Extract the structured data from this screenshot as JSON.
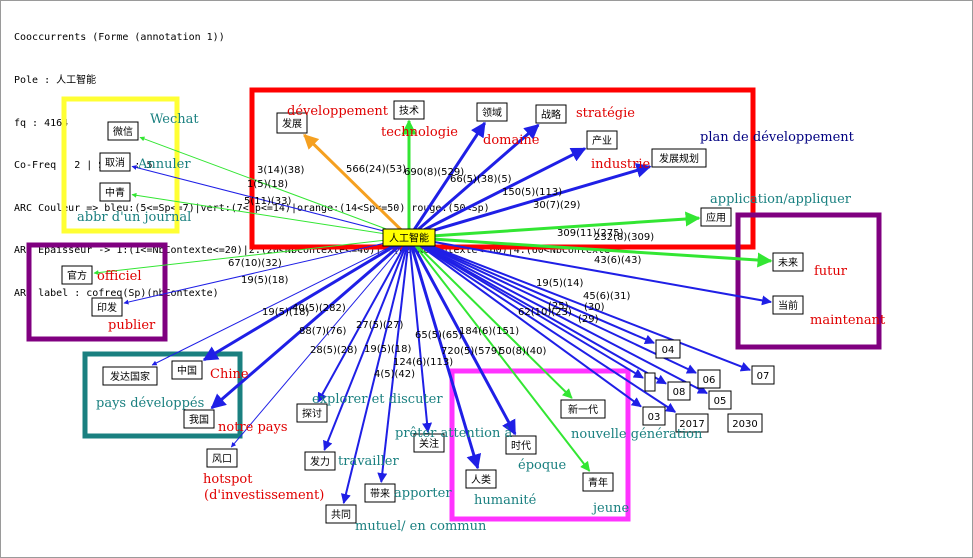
{
  "header": [
    "Cooccurrents (Forme (annotation 1))",
    "Pole : 人工智能",
    "fq : 4164",
    "Co-Freq : 2 | Seuil : 5",
    "ARC Couleur => bleu:(5<=Sp<=7)|vert:(7<Sp<=14)|orange:(14<Sp<=50)|rouge:(50<Sp)",
    "ARC Epaisseur -> 1:(1<=NbContexte<=20)|2:(20<NbContexte<=40)|3:(40<NbContexte<=60)|4:(60<NbContexte",
    "ARC label : cofreq(Sp)(nbContexte)"
  ],
  "colors": {
    "bleu": "#1f1fe6",
    "vert": "#33e633",
    "orange": "#f5a020",
    "rouge": "#e00000",
    "red_frame": "#ff0000",
    "yellow_frame": "#ffff33",
    "purple_frame": "#800080",
    "teal_frame": "#1a8080",
    "magenta_frame": "#ff33ff",
    "center_fill": "#ffff00",
    "translation_red": "#e00000",
    "translation_teal": "#1a8080",
    "translation_navy": "#000080"
  },
  "pole": "人工智能",
  "nodes": [
    {
      "id": "n_weixin",
      "text": "微信"
    },
    {
      "id": "n_quxiao",
      "text": "取消"
    },
    {
      "id": "n_zhongqi",
      "text": "中青"
    },
    {
      "id": "n_guanfang",
      "text": "官方"
    },
    {
      "id": "n_yinfa",
      "text": "印发"
    },
    {
      "id": "n_fada",
      "text": "发达国家"
    },
    {
      "id": "n_zhongguo",
      "text": "中国"
    },
    {
      "id": "n_woguo",
      "text": "我国"
    },
    {
      "id": "n_fengkou",
      "text": "风口"
    },
    {
      "id": "n_tantao",
      "text": "探讨"
    },
    {
      "id": "n_fali",
      "text": "发力"
    },
    {
      "id": "n_daile",
      "text": "带来"
    },
    {
      "id": "n_gongtong",
      "text": "共同"
    },
    {
      "id": "n_guanzhu",
      "text": "关注"
    },
    {
      "id": "n_renlei",
      "text": "人类"
    },
    {
      "id": "n_shidai",
      "text": "时代"
    },
    {
      "id": "n_xinyidai",
      "text": "新一代"
    },
    {
      "id": "n_qingnian",
      "text": "青年"
    },
    {
      "id": "n_fazhan",
      "text": "发展"
    },
    {
      "id": "n_jishu",
      "text": "技术"
    },
    {
      "id": "n_lingyu",
      "text": "领域"
    },
    {
      "id": "n_zhanlue",
      "text": "战略"
    },
    {
      "id": "n_chanye",
      "text": "产业"
    },
    {
      "id": "n_guihua",
      "text": "发展规划"
    },
    {
      "id": "n_yingyong",
      "text": "应用"
    },
    {
      "id": "n_weilai",
      "text": "未来"
    },
    {
      "id": "n_dangqian",
      "text": "当前"
    },
    {
      "id": "n_04",
      "text": "04"
    },
    {
      "id": "n_blank",
      "text": ""
    },
    {
      "id": "n_08",
      "text": "08"
    },
    {
      "id": "n_06",
      "text": "06"
    },
    {
      "id": "n_07",
      "text": "07"
    },
    {
      "id": "n_05",
      "text": "05"
    },
    {
      "id": "n_03",
      "text": "03"
    },
    {
      "id": "n_2017",
      "text": "2017"
    },
    {
      "id": "n_2030",
      "text": "2030"
    }
  ],
  "edges": [
    {
      "to": "n_fazhan",
      "color": "orange",
      "width": 3,
      "label": ""
    },
    {
      "to": "n_jishu",
      "color": "vert",
      "width": 3,
      "label": "566(24)(53)"
    },
    {
      "to": "n_lingyu",
      "color": "bleu",
      "width": 3,
      "label": "690(8)(529)"
    },
    {
      "to": "n_zhanlue",
      "color": "bleu",
      "width": 3,
      "label": "66(5)(38)(5)"
    },
    {
      "to": "n_chanye",
      "color": "bleu",
      "width": 3,
      "label": "150(5)(113)"
    },
    {
      "to": "n_guihua",
      "color": "bleu",
      "width": 3,
      "label": "30(7)(29)"
    },
    {
      "to": "n_yingyong",
      "color": "vert",
      "width": 3,
      "label": "309(11)(275)"
    },
    {
      "to": "n_weilai",
      "color": "vert",
      "width": 3,
      "label": "232(8)(309)"
    },
    {
      "to": "n_dangqian",
      "color": "bleu",
      "width": 2,
      "label": "43(6)(43)"
    },
    {
      "to": "n_weixin",
      "color": "vert",
      "width": 1,
      "label": "3(14)(38)"
    },
    {
      "to": "n_quxiao",
      "color": "bleu",
      "width": 1,
      "label": "1(5)(18)"
    },
    {
      "to": "n_zhongqi",
      "color": "vert",
      "width": 1,
      "label": "5(11)(33)"
    },
    {
      "to": "n_guanfang",
      "color": "vert",
      "width": 1,
      "label": "67(10)(32)"
    },
    {
      "to": "n_yinfa",
      "color": "bleu",
      "width": 1,
      "label": "19(5)(18)"
    },
    {
      "to": "n_fada",
      "color": "bleu",
      "width": 1,
      "label": "19(5)(18)"
    },
    {
      "to": "n_zhongguo",
      "color": "bleu",
      "width": 3,
      "label": "40(5)(282)"
    },
    {
      "to": "n_woguo",
      "color": "bleu",
      "width": 3,
      "label": "88(7)(76)"
    },
    {
      "to": "n_fengkou",
      "color": "bleu",
      "width": 1,
      "label": ""
    },
    {
      "to": "n_tantao",
      "color": "bleu",
      "width": 2,
      "label": "28(5)(28)"
    },
    {
      "to": "n_fali",
      "color": "bleu",
      "width": 2,
      "label": "27(5)(27)"
    },
    {
      "to": "n_gongtong",
      "color": "bleu",
      "width": 2,
      "label": "19(5)(18)"
    },
    {
      "to": "n_daile",
      "color": "bleu",
      "width": 2,
      "label": "4(5)(42)"
    },
    {
      "to": "n_guanzhu",
      "color": "bleu",
      "width": 2,
      "label": "124(6)(113)"
    },
    {
      "to": "n_renlei",
      "color": "bleu",
      "width": 3,
      "label": "65(5)(65)"
    },
    {
      "to": "n_shidai",
      "color": "bleu",
      "width": 3,
      "label": "720(5)(579)"
    },
    {
      "to": "n_xinyidai",
      "color": "vert",
      "width": 2,
      "label": "184(6)(151)"
    },
    {
      "to": "n_qingnian",
      "color": "vert",
      "width": 2,
      "label": "50(8)(40)"
    },
    {
      "to": "n_04",
      "color": "bleu",
      "width": 2,
      "label": "19(5)(14)"
    },
    {
      "to": "n_blank",
      "color": "bleu",
      "width": 2,
      "label": "45(6)(31)"
    },
    {
      "to": "n_08",
      "color": "bleu",
      "width": 2,
      "label": "62(10)(23)"
    },
    {
      "to": "n_06",
      "color": "bleu",
      "width": 2,
      "label": "(25)"
    },
    {
      "to": "n_07",
      "color": "bleu",
      "width": 2,
      "label": "(30)"
    },
    {
      "to": "n_05",
      "color": "bleu",
      "width": 2,
      "label": "(29)"
    },
    {
      "to": "n_03",
      "color": "bleu",
      "width": 2,
      "label": ""
    },
    {
      "to": "n_2017",
      "color": "bleu",
      "width": 2,
      "label": ""
    }
  ],
  "translations": [
    {
      "id": "t_wechat",
      "text": "Wechat",
      "color": "translation_teal"
    },
    {
      "id": "t_annuler",
      "text": "Annuler",
      "color": "translation_teal"
    },
    {
      "id": "t_abbr",
      "text": "abbr d'un journal",
      "color": "translation_teal"
    },
    {
      "id": "t_officiel",
      "text": "officiel",
      "color": "translation_red"
    },
    {
      "id": "t_publier",
      "text": "publier",
      "color": "translation_red"
    },
    {
      "id": "t_chine",
      "text": "Chine",
      "color": "translation_red"
    },
    {
      "id": "t_pays",
      "text": "pays développés",
      "color": "translation_teal"
    },
    {
      "id": "t_notre",
      "text": "notre pays",
      "color": "translation_red"
    },
    {
      "id": "t_hotspot",
      "text": "hotspot",
      "color": "translation_red"
    },
    {
      "id": "t_invest",
      "text": "(d'investissement)",
      "color": "translation_red"
    },
    {
      "id": "t_explorer",
      "text": "explorer et discuter",
      "color": "translation_teal"
    },
    {
      "id": "t_travailler",
      "text": "travailler",
      "color": "translation_teal"
    },
    {
      "id": "t_apporter",
      "text": "apporter",
      "color": "translation_teal"
    },
    {
      "id": "t_mutuel",
      "text": "mutuel/ en commun",
      "color": "translation_teal"
    },
    {
      "id": "t_preter",
      "text": "prêter attention à",
      "color": "translation_teal"
    },
    {
      "id": "t_epoque",
      "text": "époque",
      "color": "translation_teal"
    },
    {
      "id": "t_humanite",
      "text": "humanité",
      "color": "translation_teal"
    },
    {
      "id": "t_nouvelle",
      "text": "nouvelle génération",
      "color": "translation_teal"
    },
    {
      "id": "t_jeune",
      "text": "jeune",
      "color": "translation_teal"
    },
    {
      "id": "t_developpement",
      "text": "développement",
      "color": "translation_red"
    },
    {
      "id": "t_technologie",
      "text": "technologie",
      "color": "translation_red"
    },
    {
      "id": "t_domaine",
      "text": "domaine",
      "color": "translation_red"
    },
    {
      "id": "t_strategie",
      "text": "stratégie",
      "color": "translation_red"
    },
    {
      "id": "t_industrie",
      "text": "industrie",
      "color": "translation_red"
    },
    {
      "id": "t_plan",
      "text": "plan de développement",
      "color": "translation_navy"
    },
    {
      "id": "t_application",
      "text": "application/appliquer",
      "color": "translation_teal"
    },
    {
      "id": "t_futur",
      "text": "futur",
      "color": "translation_red"
    },
    {
      "id": "t_maintenant",
      "text": "maintenant",
      "color": "translation_red"
    }
  ]
}
